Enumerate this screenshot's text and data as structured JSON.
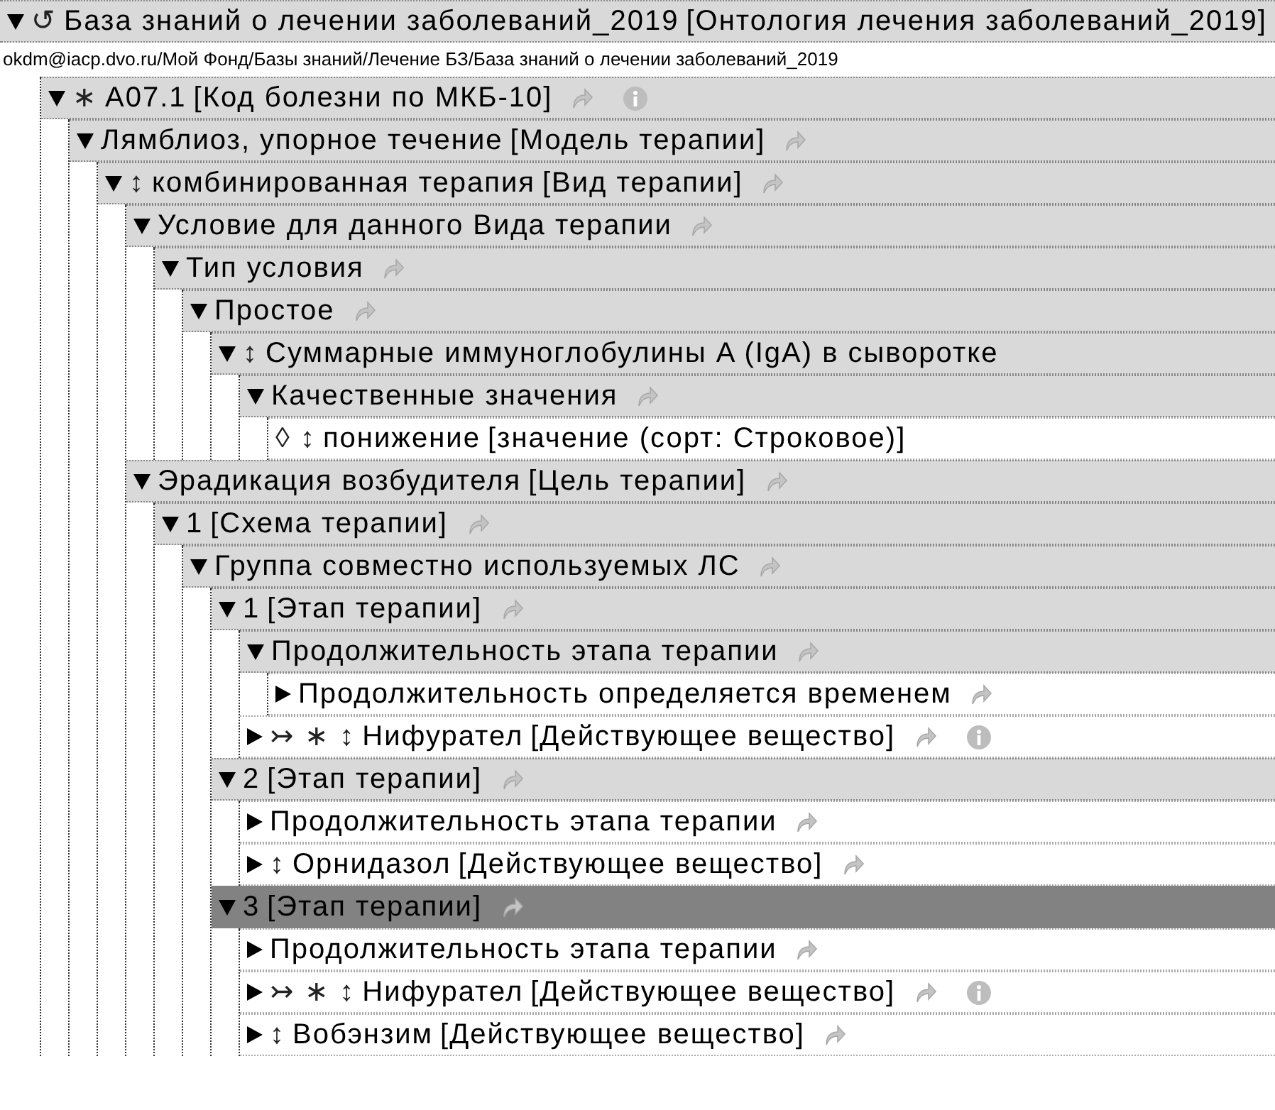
{
  "root": {
    "markers": "↺",
    "name": "База знаний о лечении заболеваний_2019",
    "type": "[Онтология лечения заболеваний_2019]",
    "kind": "branch",
    "expanded": true,
    "selected": false
  },
  "path": "okdm@iacp.dvo.ru/Мой Фонд/Базы знаний/Лечение БЗ/База знаний о лечении заболеваний_2019",
  "tree": [
    {
      "markers": "∗",
      "name": "A07.1",
      "type": "[Код болезни по МКБ-10]",
      "kind": "branch",
      "expanded": true,
      "selected": false,
      "link": true,
      "info": true,
      "children": [
        {
          "name": "Лямблиоз, упорное течение",
          "type": "[Модель терапии]",
          "kind": "branch",
          "expanded": true,
          "selected": false,
          "link": true,
          "info": false,
          "children": [
            {
              "markers": "↕",
              "name": "комбинированная терапия",
              "type": "[Вид терапии]",
              "kind": "branch",
              "expanded": true,
              "selected": false,
              "link": true,
              "info": false,
              "children": [
                {
                  "name": "Условие для данного Вида терапии",
                  "kind": "branch",
                  "expanded": true,
                  "selected": false,
                  "link": true,
                  "info": false,
                  "children": [
                    {
                      "name": "Тип условия",
                      "kind": "branch",
                      "expanded": true,
                      "selected": false,
                      "link": true,
                      "info": false,
                      "children": [
                        {
                          "name": "Простое",
                          "kind": "branch",
                          "expanded": true,
                          "selected": false,
                          "link": true,
                          "info": false,
                          "children": [
                            {
                              "markers": "↕",
                              "name": "Суммарные иммуноглобулины A (IgA) в сыворотке",
                              "kind": "branch",
                              "expanded": true,
                              "selected": false,
                              "link": false,
                              "info": false,
                              "children": [
                                {
                                  "name": "Качественные значения",
                                  "kind": "branch",
                                  "expanded": true,
                                  "selected": false,
                                  "link": true,
                                  "info": false,
                                  "children": [
                                    {
                                      "markers": "◊ ↕",
                                      "name": "понижение",
                                      "type": "[значение (сорт: Строковое)]",
                                      "kind": "leaf",
                                      "selected": false,
                                      "link": false,
                                      "info": false
                                    }
                                  ]
                                }
                              ]
                            }
                          ]
                        }
                      ]
                    }
                  ]
                },
                {
                  "name": "Эрадикация возбудителя",
                  "type": "[Цель терапии]",
                  "kind": "branch",
                  "expanded": true,
                  "selected": false,
                  "link": true,
                  "info": false,
                  "children": [
                    {
                      "name": "1",
                      "type": "[Схема терапии]",
                      "kind": "branch",
                      "expanded": true,
                      "selected": false,
                      "link": true,
                      "info": false,
                      "children": [
                        {
                          "name": "Группа совместно используемых ЛС",
                          "kind": "branch",
                          "expanded": true,
                          "selected": false,
                          "link": true,
                          "info": false,
                          "children": [
                            {
                              "name": "1",
                              "type": "[Этап терапии]",
                              "kind": "branch",
                              "expanded": true,
                              "selected": false,
                              "link": true,
                              "info": false,
                              "children": [
                                {
                                  "name": "Продолжительность этапа терапии",
                                  "kind": "branch",
                                  "expanded": true,
                                  "selected": false,
                                  "link": true,
                                  "info": false,
                                  "children": [
                                    {
                                      "name": "Продолжительность определяется временем",
                                      "kind": "branch",
                                      "expanded": false,
                                      "selected": false,
                                      "link": true,
                                      "info": false
                                    }
                                  ]
                                },
                                {
                                  "markers": "↣ ∗ ↕",
                                  "name": "Нифурател",
                                  "type": "[Действующее вещество]",
                                  "kind": "branch",
                                  "expanded": false,
                                  "selected": false,
                                  "link": true,
                                  "info": true
                                }
                              ]
                            },
                            {
                              "name": "2",
                              "type": "[Этап терапии]",
                              "kind": "branch",
                              "expanded": true,
                              "selected": false,
                              "link": true,
                              "info": false,
                              "children": [
                                {
                                  "name": "Продолжительность этапа терапии",
                                  "kind": "branch",
                                  "expanded": false,
                                  "selected": false,
                                  "link": true,
                                  "info": false
                                },
                                {
                                  "markers": "↕",
                                  "name": "Орнидазол",
                                  "type": "[Действующее вещество]",
                                  "kind": "branch",
                                  "expanded": false,
                                  "selected": false,
                                  "link": true,
                                  "info": false
                                }
                              ]
                            },
                            {
                              "name": "3",
                              "type": "[Этап терапии]",
                              "kind": "branch",
                              "expanded": true,
                              "selected": true,
                              "link": true,
                              "info": false,
                              "children": [
                                {
                                  "name": "Продолжительность этапа терапии",
                                  "kind": "branch",
                                  "expanded": false,
                                  "selected": false,
                                  "link": true,
                                  "info": false
                                },
                                {
                                  "markers": "↣ ∗ ↕",
                                  "name": "Нифурател",
                                  "type": "[Действующее вещество]",
                                  "kind": "branch",
                                  "expanded": false,
                                  "selected": false,
                                  "link": true,
                                  "info": true
                                },
                                {
                                  "markers": "↕",
                                  "name": "Вобэнзим",
                                  "type": "[Действующее вещество]",
                                  "kind": "branch",
                                  "expanded": false,
                                  "selected": false,
                                  "link": true,
                                  "info": false
                                }
                              ]
                            }
                          ]
                        }
                      ]
                    }
                  ]
                }
              ]
            }
          ]
        }
      ]
    }
  ]
}
